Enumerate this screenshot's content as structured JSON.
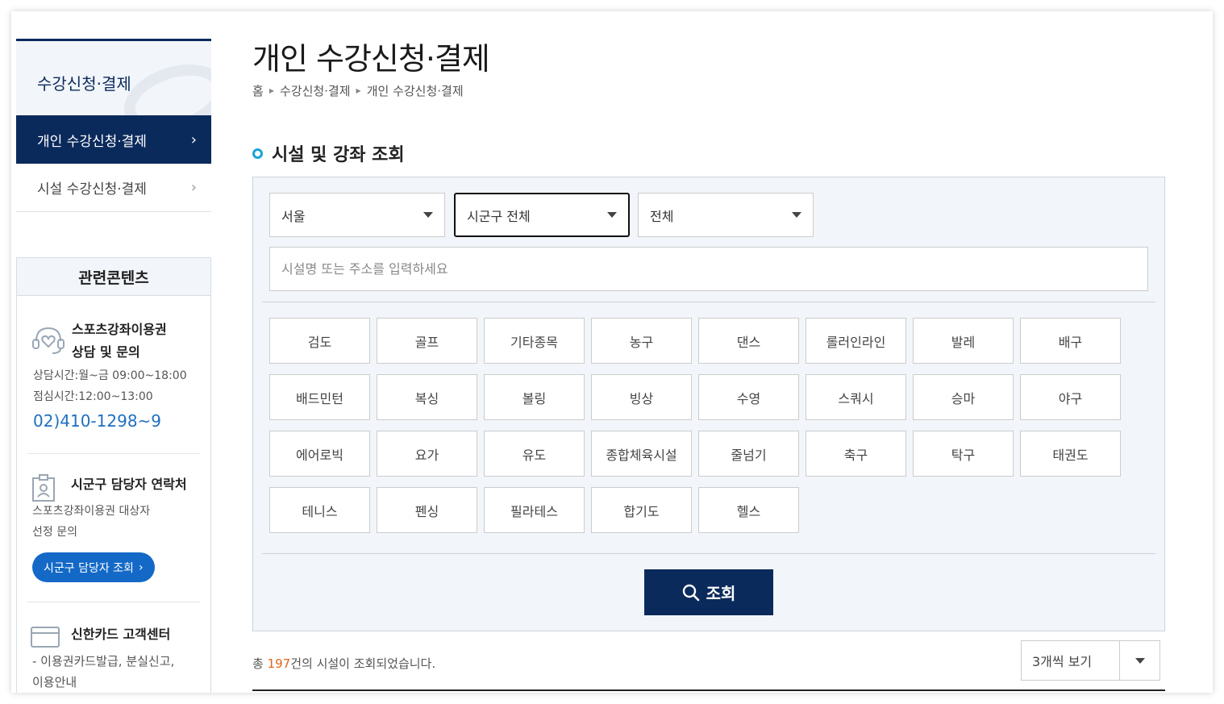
{
  "sidebar": {
    "heading": "수강신청·결제",
    "items": [
      {
        "label": "개인 수강신청·결제",
        "active": true
      },
      {
        "label": "시설 수강신청·결제",
        "active": false
      }
    ]
  },
  "related": {
    "heading": "관련콘텐츠",
    "consult": {
      "title_line1": "스포츠강좌이용권",
      "title_line2": "상담 및 문의",
      "hours": "상담시간:월~금 09:00~18:00",
      "lunch": "점심시간:12:00~13:00",
      "phone": "02)410-1298~9"
    },
    "contact": {
      "title": "시군구 담당자 연락처",
      "desc_line1": "스포츠강좌이용권 대상자",
      "desc_line2": "선정 문의",
      "button": "시군구 담당자 조회",
      "button_chevron": "›"
    },
    "card": {
      "title": "신한카드 고객센터",
      "desc_line1": "- 이용권카드발급, 분실신고,",
      "desc_line2": "이용안내"
    }
  },
  "page": {
    "title": "개인 수강신청·결제",
    "breadcrumb": [
      "홈",
      "수강신청·결제",
      "개인 수강신청·결제"
    ]
  },
  "search": {
    "section_title": "시설 및 강좌 조회",
    "selects": [
      "서울",
      "시군구 전체",
      "전체"
    ],
    "input_placeholder": "시설명 또는 주소를 입력하세요",
    "input_value": "",
    "categories": [
      "검도",
      "골프",
      "기타종목",
      "농구",
      "댄스",
      "롤러인라인",
      "발레",
      "배구",
      "배드민턴",
      "복싱",
      "볼링",
      "빙상",
      "수영",
      "스쿼시",
      "승마",
      "야구",
      "에어로빅",
      "요가",
      "유도",
      "종합체육시설",
      "줄넘기",
      "축구",
      "탁구",
      "태권도",
      "테니스",
      "펜싱",
      "필라테스",
      "합기도",
      "헬스"
    ],
    "button": "조회"
  },
  "results": {
    "prefix": "총 ",
    "count": "197",
    "suffix": "건의 시설이 조회되었습니다.",
    "per_page": "3개씩 보기"
  },
  "colors": {
    "navy": "#0b2a5c",
    "accent_blue": "#1469c7",
    "count_orange": "#e0651b",
    "bullet_cyan": "#1aa3d9"
  }
}
